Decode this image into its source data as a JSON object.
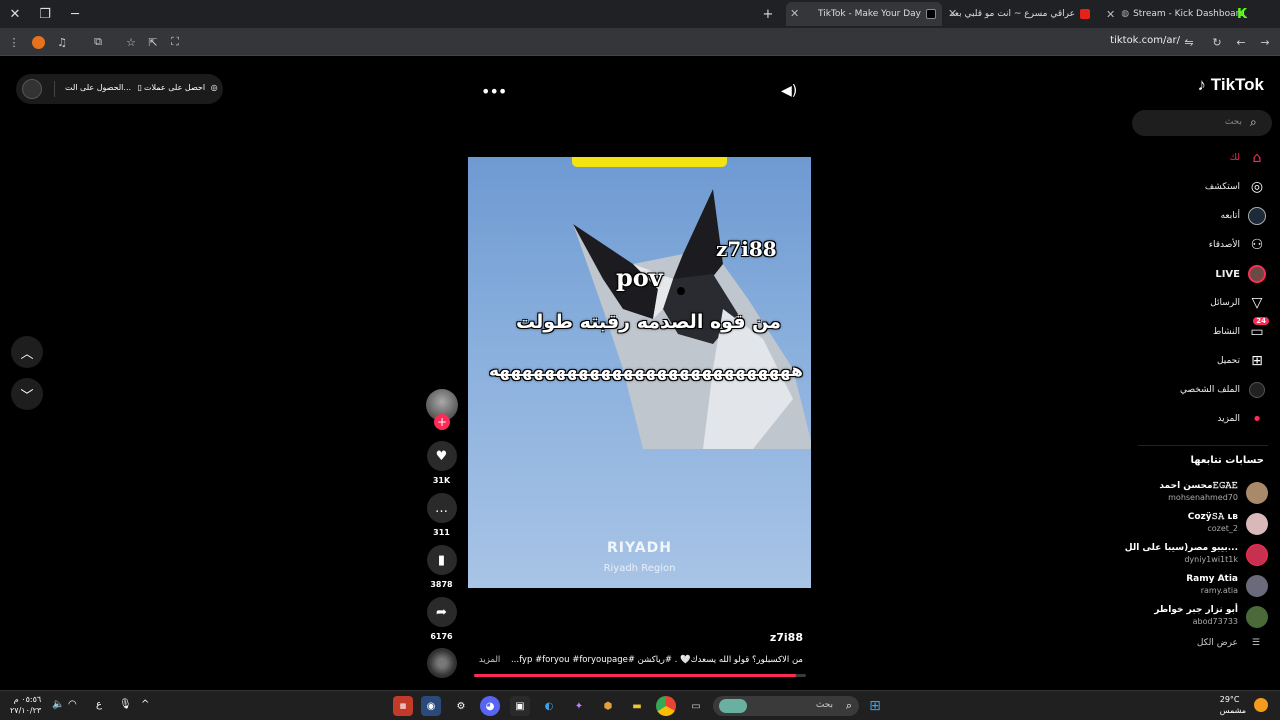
{
  "browser": {
    "tabs": [
      {
        "title": "Stream - Kick Dashboard",
        "active": false
      },
      {
        "title": "عراقي مسرع ~ انت مو قلبي بعد",
        "active": false
      },
      {
        "title": "TikTok - Make Your Day",
        "active": true
      }
    ],
    "url": "tiktok.com/ar/"
  },
  "topbar": {
    "get_coins": "احصل على عملات",
    "get_app": "الحصول على الت..."
  },
  "sidebar": {
    "logo": "TikTok",
    "search_placeholder": "بحث",
    "nav": [
      {
        "label": "لك",
        "icon": "home-icon"
      },
      {
        "label": "استكشف",
        "icon": "compass-icon"
      },
      {
        "label": "أتابعه",
        "icon": "following-icon"
      },
      {
        "label": "الأصدقاء",
        "icon": "friends-icon"
      },
      {
        "label": "LIVE",
        "icon": "live-icon"
      },
      {
        "label": "الرسائل",
        "icon": "send-icon"
      },
      {
        "label": "النشاط",
        "icon": "activity-icon",
        "badge": "24"
      },
      {
        "label": "تحميل",
        "icon": "upload-icon"
      },
      {
        "label": "الملف الشخصي",
        "icon": "profile-icon"
      },
      {
        "label": "المزيد",
        "icon": "more-icon"
      }
    ],
    "following_title": "حسابات تتابعها",
    "accounts": [
      {
        "name": "محسن احمد𝙴𝙶𝙰𝙴",
        "username": "mohsenahmed70"
      },
      {
        "name": "Cozÿ𝚂𝙰 ʟʙ",
        "username": "cozet_2"
      },
      {
        "name": "بيبو مصر(سيبا على الل...",
        "username": "dyniy1wi1t1k"
      },
      {
        "name": "Ramy Atia",
        "username": "ramy.atia"
      },
      {
        "name": "أبو نزار جبر خواطر",
        "username": "abod73733"
      }
    ],
    "see_all": "عرض الكل"
  },
  "video": {
    "overlay_name": "z7i88",
    "overlay_pov": "pov",
    "overlay_line1": "من قوه الصدمه رقبته طولت",
    "overlay_line2": "هههههههههههههههههههههههههههه",
    "watermark_city": "RIYADH",
    "watermark_region": "Riyadh Region",
    "username": "z7i88",
    "caption": "من الاكسبلور؟ قولو الله يسعدك🤍 . #رياكشن #fyp #foryou #foryoupage...",
    "more": "المزيد",
    "progress": 0.97
  },
  "actions": {
    "likes": "31K",
    "comments": "311",
    "saves": "3878",
    "shares": "6176"
  },
  "taskbar": {
    "search": "بحث",
    "time": "٠٥:٥٦ م",
    "date": "٢٧/١٠/٢٣",
    "lang": "ع",
    "temp": "29°C",
    "weather": "مشمس"
  }
}
